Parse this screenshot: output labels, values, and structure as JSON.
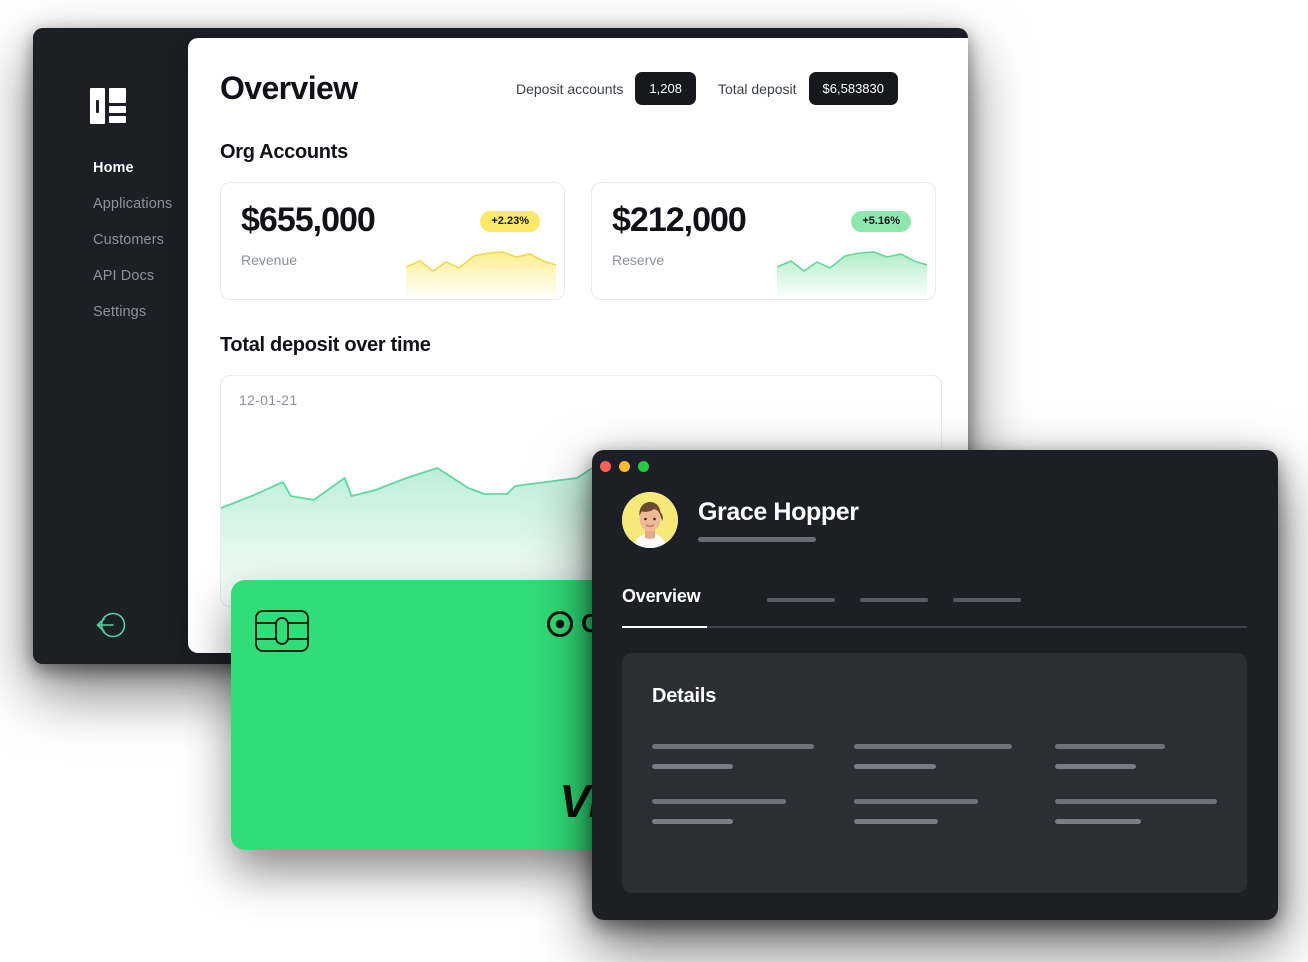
{
  "sidebar": {
    "logo_icon": "app-logo-icon",
    "items": [
      {
        "label": "Home",
        "active": true
      },
      {
        "label": "Applications",
        "active": false
      },
      {
        "label": "Customers",
        "active": false
      },
      {
        "label": "API Docs",
        "active": false
      },
      {
        "label": "Settings",
        "active": false
      }
    ],
    "logout_icon": "logout-arrow-icon"
  },
  "dashboard": {
    "page_title": "Overview",
    "header_stats": [
      {
        "label": "Deposit accounts",
        "value": "1,208"
      },
      {
        "label": "Total deposit",
        "value": "$6,583830"
      }
    ],
    "org_accounts": {
      "section_title": "Org Accounts",
      "cards": [
        {
          "value": "$655,000",
          "caption": "Revenue",
          "change": "+2.23%",
          "accent": "#fbe96a"
        },
        {
          "value": "$212,000",
          "caption": "Reserve",
          "change": "+5.16%",
          "accent": "#8ee7ac"
        }
      ]
    },
    "deposit_chart": {
      "section_title": "Total deposit over time",
      "date_label": "12-01-21"
    }
  },
  "chart_data": [
    {
      "type": "area",
      "name": "Total deposit over time",
      "title": "Total deposit over time",
      "xlabel": "",
      "ylabel": "",
      "grid": false,
      "legend": "none",
      "line_color": "#5fd9a0",
      "fill_color": "#d6f2e4",
      "categories": [
        "12-01-21"
      ],
      "x": [
        0,
        1,
        2,
        3,
        4,
        5,
        6,
        7,
        8,
        9,
        10,
        11,
        12,
        13,
        14,
        15,
        16,
        17,
        18,
        19,
        20,
        21,
        22
      ],
      "values": [
        30,
        44,
        52,
        38,
        56,
        45,
        50,
        62,
        48,
        42,
        42,
        47,
        52,
        55,
        70,
        58,
        52,
        60,
        66,
        54,
        58,
        62,
        60
      ],
      "ylim": [
        0,
        100
      ]
    },
    {
      "type": "area",
      "name": "Revenue sparkline",
      "title": "",
      "grid": false,
      "legend": "none",
      "line_color": "#f2d94a",
      "fill_color": "#fdf6c8",
      "x": [
        0,
        1,
        2,
        3,
        4,
        5,
        6,
        7,
        8,
        9,
        10,
        11
      ],
      "values": [
        48,
        60,
        42,
        56,
        46,
        68,
        72,
        74,
        73,
        64,
        70,
        58
      ],
      "ylim": [
        0,
        100
      ]
    },
    {
      "type": "area",
      "name": "Reserve sparkline",
      "title": "",
      "grid": false,
      "legend": "none",
      "line_color": "#63d79b",
      "fill_color": "#d4f1e2",
      "x": [
        0,
        1,
        2,
        3,
        4,
        5,
        6,
        7,
        8,
        9,
        10,
        11
      ],
      "values": [
        48,
        60,
        42,
        56,
        46,
        68,
        72,
        74,
        73,
        64,
        70,
        58
      ],
      "ylim": [
        0,
        100
      ]
    }
  ],
  "credit_card": {
    "chip_icon": "emv-chip-icon",
    "brand_icon": "outline-target-icon",
    "brand_name": "Outl",
    "network": "VIS",
    "color": "#31dd78"
  },
  "profile_window": {
    "traffic_lights": [
      "#ff5f57",
      "#febc2e",
      "#28c840"
    ],
    "avatar_icon": "user-avatar-photo",
    "name": "Grace Hopper",
    "tabs": {
      "active_label": "Overview",
      "placeholder_count": 3
    },
    "details": {
      "title": "Details",
      "placeholder_rows": 2,
      "placeholder_columns": 3
    }
  }
}
